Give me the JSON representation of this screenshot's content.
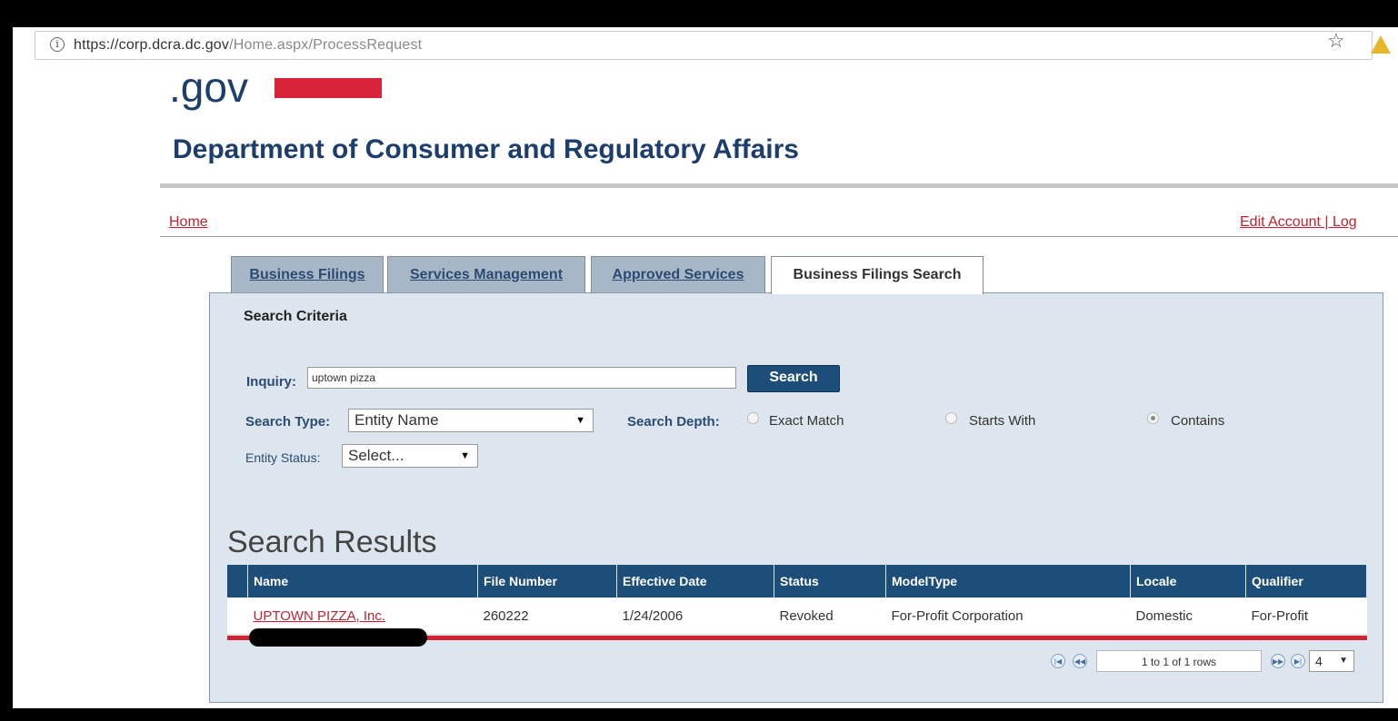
{
  "browser": {
    "url_host": "https://corp.dcra.dc.gov",
    "url_path": "/Home.aspx/ProcessRequest"
  },
  "header": {
    "logo_text": ".gov",
    "title": "Department of Consumer and Regulatory Affairs",
    "home_link": "Home",
    "account_links": "Edit Account | Log"
  },
  "tabs": [
    {
      "label": "Business Filings"
    },
    {
      "label": "Services Management"
    },
    {
      "label": "Approved Services"
    },
    {
      "label": "Business Filings Search",
      "active": true
    }
  ],
  "search": {
    "section_label": "Search Criteria",
    "inquiry_label": "Inquiry:",
    "inquiry_value": "uptown pizza",
    "search_button": "Search",
    "search_type_label": "Search Type:",
    "search_type_value": "Entity Name",
    "search_depth_label": "Search Depth:",
    "depth_options": [
      {
        "label": "Exact Match",
        "selected": false
      },
      {
        "label": "Starts With",
        "selected": false
      },
      {
        "label": "Contains",
        "selected": true
      }
    ],
    "entity_status_label": "Entity Status:",
    "entity_status_value": "Select..."
  },
  "results": {
    "title": "Search Results",
    "columns": [
      "Name",
      "File Number",
      "Effective Date",
      "Status",
      "ModelType",
      "Locale",
      "Qualifier"
    ],
    "rows": [
      {
        "name": "UPTOWN PIZZA, Inc.",
        "file_number": "260222",
        "effective_date": "1/24/2006",
        "status": "Revoked",
        "model_type": "For-Profit Corporation",
        "locale": "Domestic",
        "qualifier": "For-Profit"
      }
    ],
    "pager_info": "1 to 1 of 1 rows",
    "page_size": "4"
  },
  "colors": {
    "brand_blue": "#1d4e7a",
    "accent_red": "#d12330"
  }
}
